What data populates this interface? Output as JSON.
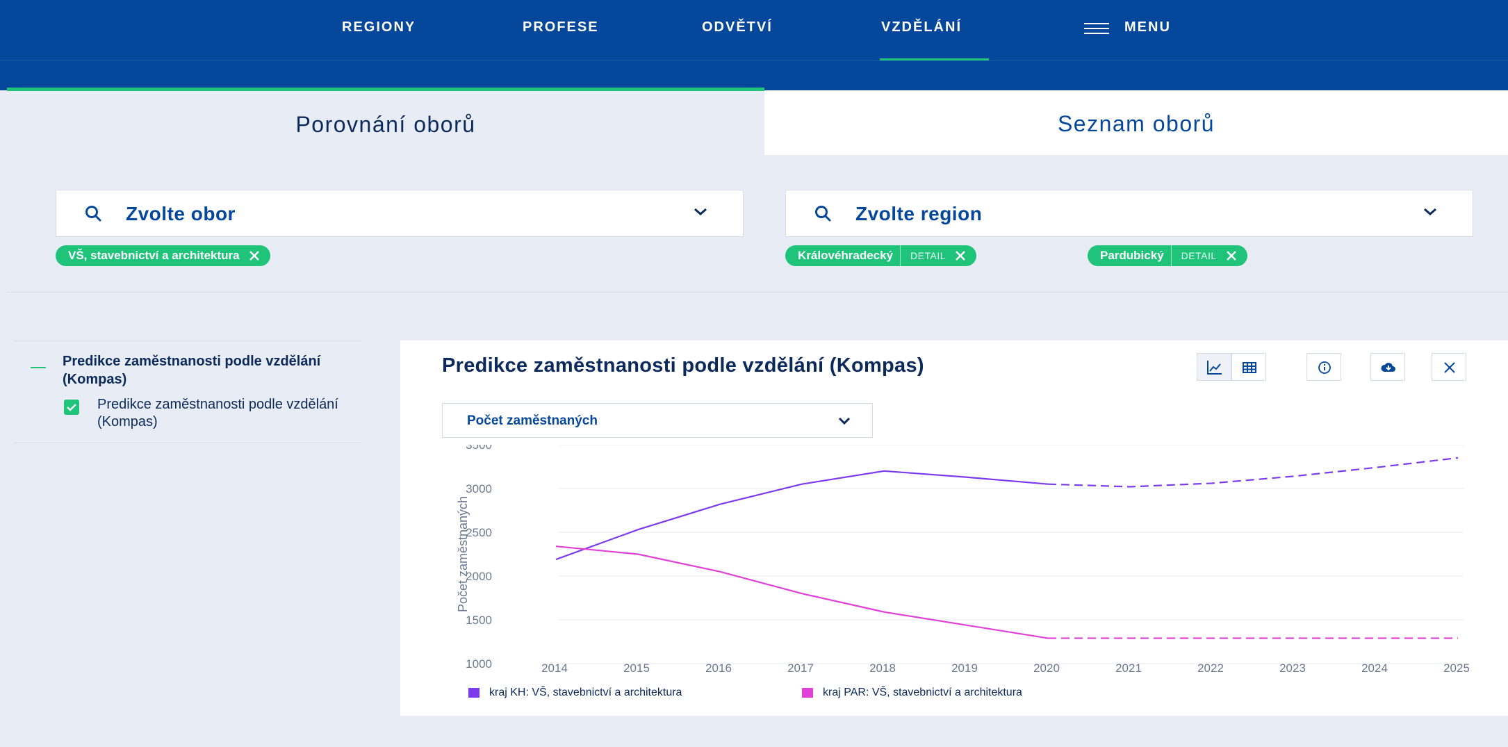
{
  "nav": {
    "items": [
      {
        "label": "REGIONY"
      },
      {
        "label": "PROFESE"
      },
      {
        "label": "ODVĚTVÍ"
      },
      {
        "label": "VZDĚLÁNÍ"
      }
    ],
    "menu_label": "MENU",
    "active": "VZDĚLÁNÍ"
  },
  "tabs": [
    {
      "label": "Porovnání oborů",
      "active": true
    },
    {
      "label": "Seznam oborů",
      "active": false
    }
  ],
  "filters": {
    "field_select": {
      "label": "Zvolte obor"
    },
    "region_select": {
      "label": "Zvolte region"
    },
    "field_chips": [
      {
        "label": "VŠ, stavebnictví a architektura"
      }
    ],
    "region_chips": [
      {
        "label": "Královéhradecký",
        "detail": "DETAIL"
      },
      {
        "label": "Pardubický",
        "detail": "DETAIL"
      }
    ]
  },
  "side_panel": {
    "title": "Predikce zaměstnanosti podle vzdělání (Kompas)",
    "item": "Predikce zaměstnanosti podle vzdělání (Kompas)",
    "checked": true
  },
  "card": {
    "title": "Predikce zaměstnanosti podle vzdělání (Kompas)",
    "tools": [
      "chart-line-icon",
      "table-icon",
      "info-icon",
      "cloud-download-icon",
      "close-icon"
    ],
    "metric_select": "Počet zaměstnaných"
  },
  "colors": {
    "nav_bg": "#05479a",
    "accent_green": "#1fc47a",
    "series_kh": "#7c3aed",
    "series_par": "#e040d8"
  },
  "chart_data": {
    "type": "line",
    "title": "",
    "xlabel": "",
    "ylabel": "Počet zaměstnaných",
    "ylim": [
      1000,
      3500
    ],
    "yticks": [
      1000,
      1500,
      2000,
      2500,
      3000,
      3500
    ],
    "x": [
      2014,
      2015,
      2016,
      2017,
      2018,
      2019,
      2020,
      2021,
      2022,
      2023,
      2024,
      2025
    ],
    "forecast_from": 2020,
    "grid": true,
    "legend_position": "bottom-left",
    "series": [
      {
        "name": "kraj KH: VŠ, stavebnictví a architektura",
        "color": "#7c3aed",
        "values": [
          2190,
          2530,
          2820,
          3050,
          3200,
          3130,
          3050,
          3020,
          3060,
          3140,
          3240,
          3350
        ]
      },
      {
        "name": "kraj PAR: VŠ, stavebnictví a architektura",
        "color": "#e040d8",
        "values": [
          2340,
          2250,
          2050,
          1800,
          1590,
          1440,
          1290,
          1290,
          1290,
          1290,
          1290,
          1290
        ]
      }
    ]
  }
}
